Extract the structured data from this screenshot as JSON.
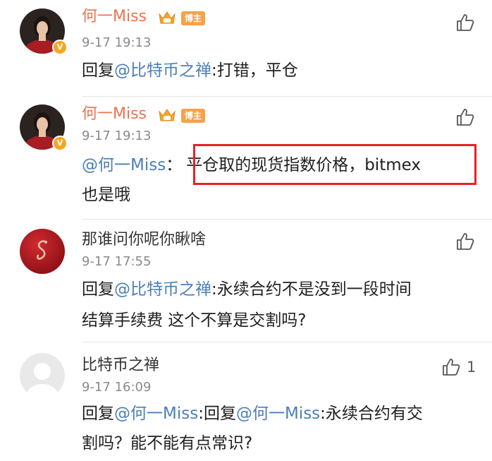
{
  "colors": {
    "name_vip": "#eb7350",
    "mention": "#4a7fb8",
    "highlight": "#e8202a",
    "badge": "#f7a14b"
  },
  "comments": [
    {
      "author": "何一Miss",
      "badge": "博主",
      "time": "9-17 19:13",
      "prefix": "回复",
      "mention": "@比特币之禅",
      "text": ":打错，平仓",
      "avatar_icon": "woman-avatar-icon",
      "like_count": ""
    },
    {
      "author": "何一Miss",
      "badge": "博主",
      "time": "9-17 19:13",
      "mention": "@何一Miss",
      "colon": "：",
      "highlighted_text": "平仓取的现货指数价格，bitmex",
      "line2": "也是哦",
      "avatar_icon": "woman-avatar-icon",
      "like_count": ""
    },
    {
      "author": "那谁问你呢你瞅啥",
      "time": "9-17 17:55",
      "prefix": "回复",
      "mention": "@比特币之禅",
      "text": ":永续合约不是没到一段时间",
      "line2": "结算手续费 这个不算是交割吗?",
      "avatar_icon": "red-dragon-avatar-icon",
      "like_count": ""
    },
    {
      "author": "比特币之禅",
      "time": "9-17 16:09",
      "prefix": "回复",
      "mention": "@何一Miss",
      "mid": ":回复",
      "mention2": "@何一Miss",
      "text": ":永续合约有交",
      "line2": "割吗？能不能有点常识?",
      "avatar_icon": "default-avatar-icon",
      "like_count": "1"
    }
  ]
}
